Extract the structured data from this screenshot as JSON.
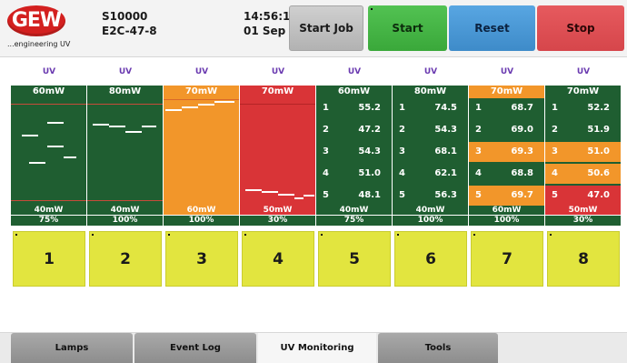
{
  "header": {
    "logo_text": "GEW",
    "logo_tagline": "...engineering UV",
    "system_id": "S10000",
    "model": "E2C-47-8",
    "time": "14:56:12",
    "date": "01 Sep",
    "buttons": {
      "start_job": "Start Job",
      "start": "Start",
      "reset": "Reset",
      "stop": "Stop"
    }
  },
  "uv_labels": [
    "UV",
    "UV",
    "UV",
    "UV",
    "UV",
    "UV",
    "UV",
    "UV"
  ],
  "channels": [
    {
      "upper": "60mW",
      "lower": "40mW",
      "percent": "75%",
      "state": "green"
    },
    {
      "upper": "80mW",
      "lower": "40mW",
      "percent": "100%",
      "state": "green"
    },
    {
      "upper": "70mW",
      "lower": "60mW",
      "percent": "100%",
      "state": "orange"
    },
    {
      "upper": "70mW",
      "lower": "50mW",
      "percent": "30%",
      "state": "red"
    },
    {
      "upper": "60mW",
      "lower": "40mW",
      "percent": "75%",
      "state": "green",
      "readings": [
        {
          "n": "1",
          "v": "55.2"
        },
        {
          "n": "2",
          "v": "47.2"
        },
        {
          "n": "3",
          "v": "54.3"
        },
        {
          "n": "4",
          "v": "51.0"
        },
        {
          "n": "5",
          "v": "48.1"
        }
      ]
    },
    {
      "upper": "80mW",
      "lower": "40mW",
      "percent": "100%",
      "state": "green",
      "readings": [
        {
          "n": "1",
          "v": "74.5"
        },
        {
          "n": "2",
          "v": "54.3"
        },
        {
          "n": "3",
          "v": "68.1"
        },
        {
          "n": "4",
          "v": "62.1"
        },
        {
          "n": "5",
          "v": "56.3"
        }
      ]
    },
    {
      "upper": "70mW",
      "lower": "60mW",
      "percent": "100%",
      "state": "orange",
      "readings": [
        {
          "n": "1",
          "v": "68.7"
        },
        {
          "n": "2",
          "v": "69.0"
        },
        {
          "n": "3",
          "v": "69.3"
        },
        {
          "n": "4",
          "v": "68.8"
        },
        {
          "n": "5",
          "v": "69.7"
        }
      ]
    },
    {
      "upper": "70mW",
      "lower": "50mW",
      "percent": "30%",
      "state": "red",
      "readings": [
        {
          "n": "1",
          "v": "52.2"
        },
        {
          "n": "2",
          "v": "51.9"
        },
        {
          "n": "3",
          "v": "51.0"
        },
        {
          "n": "4",
          "v": "50.6"
        },
        {
          "n": "5",
          "v": "47.0"
        }
      ]
    }
  ],
  "lamps": [
    "1",
    "2",
    "3",
    "4",
    "5",
    "6",
    "7",
    "8"
  ],
  "tabs": [
    {
      "label": "Lamps"
    },
    {
      "label": "Event Log"
    },
    {
      "label": "UV Monitoring"
    },
    {
      "label": "Tools"
    }
  ],
  "colors": {
    "ok": "#1f5e31",
    "warning": "#f2962a",
    "alarm": "#d93437",
    "lamp_button": "#e2e53f",
    "uv_label": "#6a3ab0"
  }
}
